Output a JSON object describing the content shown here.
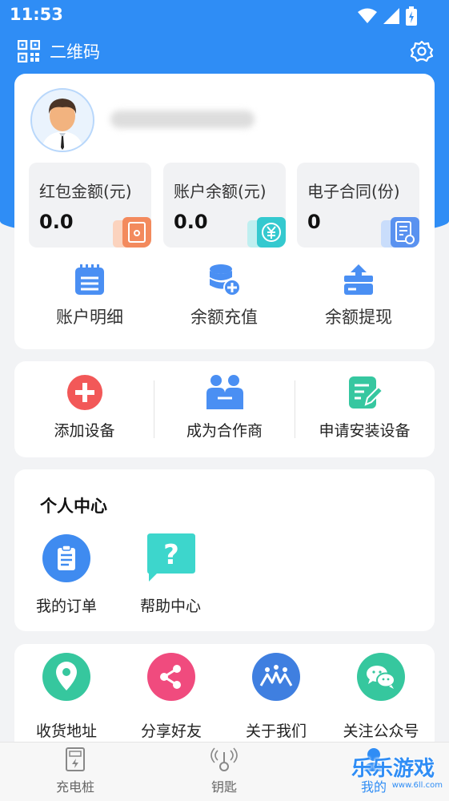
{
  "status_bar": {
    "time": "11:53"
  },
  "header": {
    "qr_label": "二维码"
  },
  "profile": {
    "stats": [
      {
        "label": "红包金额(元)",
        "value": "0.0"
      },
      {
        "label": "账户余额(元)",
        "value": "0.0"
      },
      {
        "label": "电子合同(份)",
        "value": "0"
      }
    ],
    "actions": [
      {
        "label": "账户明细"
      },
      {
        "label": "余额充值"
      },
      {
        "label": "余额提现"
      }
    ]
  },
  "ops": [
    {
      "label": "添加设备"
    },
    {
      "label": "成为合作商"
    },
    {
      "label": "申请安装设备"
    }
  ],
  "personal_center": {
    "title": "个人中心",
    "items": [
      {
        "label": "我的订单"
      },
      {
        "label": "帮助中心"
      }
    ]
  },
  "more": [
    {
      "label": "收货地址"
    },
    {
      "label": "分享好友"
    },
    {
      "label": "关于我们"
    },
    {
      "label": "关注公众号"
    }
  ],
  "tabs": [
    {
      "label": "充电桩"
    },
    {
      "label": "钥匙"
    },
    {
      "label": "我的"
    }
  ],
  "watermark": {
    "text": "乐乐游戏",
    "sub": "www.6ll.com"
  },
  "colors": {
    "primary": "#2f8df5",
    "accent_red": "#f25858",
    "accent_teal": "#36c7c0"
  }
}
